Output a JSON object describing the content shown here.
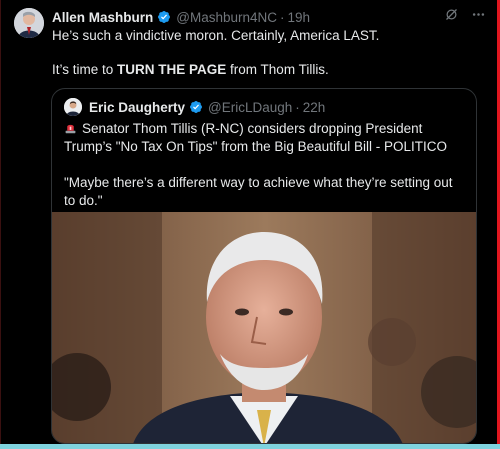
{
  "tweet": {
    "author_name": "Allen Mashburn",
    "author_handle": "@Mashburn4NC",
    "separator": "·",
    "time": "19h",
    "line1": "He’s such a vindictive moron. Certainly, America LAST.",
    "line2_prefix": "It’s time to ",
    "line2_bold": "TURN THE PAGE",
    "line2_suffix": " from Thom Tillis."
  },
  "quote": {
    "author_name": "Eric Daugherty",
    "author_handle": "@EricLDaugh",
    "separator": "·",
    "time": "22h",
    "text1": "Senator Thom Tillis (R-NC) considers dropping President Trump’s \"No Tax On Tips\" from the Big Beautiful Bill - POLITICO",
    "text2": "\"Maybe there’s a different way to achieve what they’re setting out to do.\""
  },
  "icons": {
    "verified": "verified-badge-icon",
    "grok": "grok-icon",
    "more": "more-icon",
    "siren": "siren-emoji-icon"
  },
  "colors": {
    "background": "#000000",
    "text": "#e7e9ea",
    "muted": "#71767b",
    "verified": "#1d9bf0",
    "border": "#2f3336"
  }
}
